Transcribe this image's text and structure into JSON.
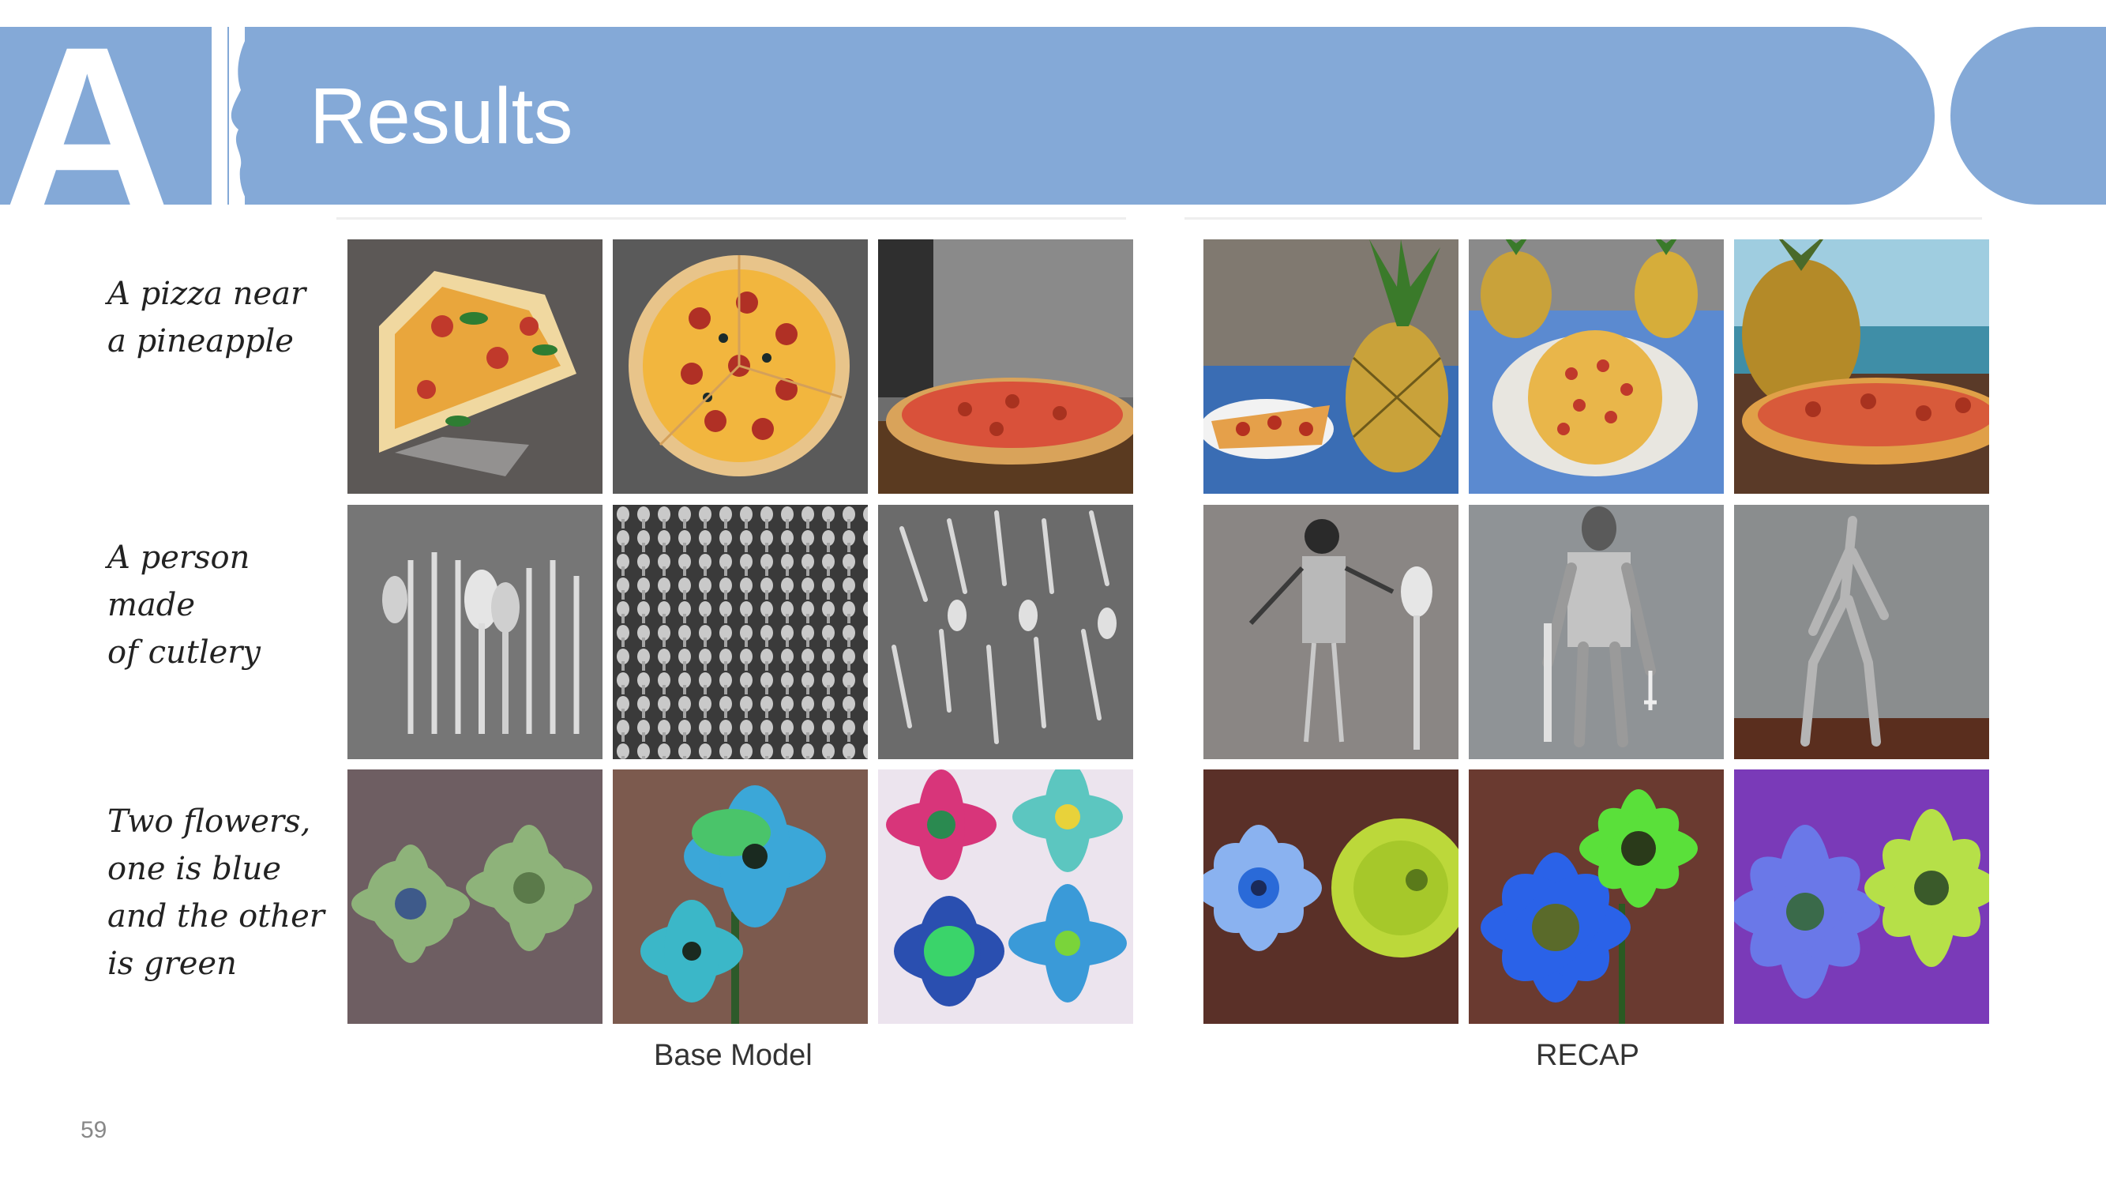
{
  "slide": {
    "title": "Results",
    "page_number": "59",
    "logo_letters": "AI"
  },
  "prompts": [
    "A pizza near\n a pineapple",
    "A person made\n of cutlery",
    "Two flowers,\n one is blue\n and the other\n is green"
  ],
  "captions": {
    "left": "Base Model",
    "right": "RECAP"
  },
  "images": {
    "base_model": [
      [
        "pizza-slices-with-basil-image",
        "pepperoni-pizza-image",
        "pizza-on-table-image"
      ],
      [
        "cutlery-set-image",
        "cutlery-pile-image",
        "scattered-cutlery-image"
      ],
      [
        "green-flowers-image",
        "blue-flower-image",
        "painted-flowers-image"
      ]
    ],
    "recap": [
      [
        "pizza-slice-and-pineapple-image",
        "pizza-plate-and-pineapples-image",
        "pizza-pineapple-beach-image"
      ],
      [
        "spoon-figure-image",
        "fork-robot-figure-image",
        "metal-figure-image"
      ],
      [
        "blue-and-green-flowers-image",
        "blue-and-green-flowers-closeup-image",
        "purple-and-green-daisies-image"
      ]
    ]
  },
  "colors": {
    "banner": "#84a9d7",
    "title_text": "#ffffff"
  }
}
